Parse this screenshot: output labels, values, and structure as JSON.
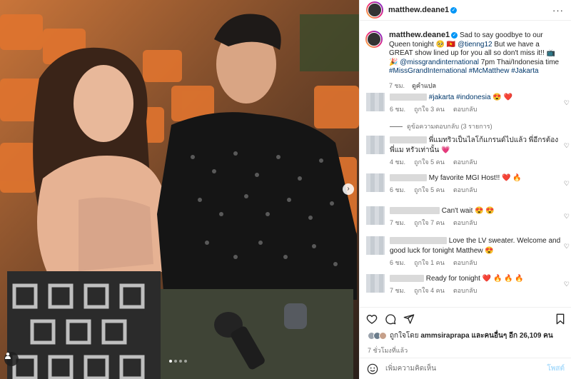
{
  "post": {
    "username": "matthew.deane1",
    "caption_pre": "Sad to say goodbye to our Queen tonight 🥺 🇻🇳 ",
    "mention_1": "@tienng12",
    "caption_mid": " But we have a GREAT show lined up for you all so don't miss it!! 📺 🎉 ",
    "mention_2": "@missgrandinternational",
    "caption_time": " 7pm Thai/Indonesia time ",
    "hashtag_1": "#MissGrandInternational",
    "hashtag_2": "#McMatthew",
    "hashtag_3": "#Jakarta",
    "time": "7 ชม.",
    "see_translation": "ดูคำแปล",
    "more_icon": "more-horizontal-icon"
  },
  "comments": [
    {
      "text_pre": "",
      "tags": "#jakarta #indonesia",
      "emoji": " 😍 ❤️",
      "time": "6 ชม.",
      "likes": "ถูกใจ 3 คน",
      "reply": "ตอบกลับ"
    },
    {
      "text_pre": "พี่แมทริวเป็นไลโก้แกรนด์ไปแล้ว พี่อีกรต้องพี่แม หรัวเท่านั้น 💗",
      "tags": "",
      "emoji": "",
      "time": "4 ชม.",
      "likes": "ถูกใจ 5 คน",
      "reply": "ตอบกลับ"
    },
    {
      "text_pre": "My favorite MGI Host!! ❤️ 🔥",
      "tags": "",
      "emoji": "",
      "time": "6 ชม.",
      "likes": "ถูกใจ 5 คน",
      "reply": "ตอบกลับ"
    },
    {
      "text_pre": "Can't wait 😍 😍",
      "tags": "",
      "emoji": "",
      "time": "7 ชม.",
      "likes": "ถูกใจ 7 คน",
      "reply": "ตอบกลับ"
    },
    {
      "text_pre": "Love the LV sweater. Welcome and good luck for tonight Matthew 😍",
      "tags": "",
      "emoji": "",
      "time": "6 ชม.",
      "likes": "ถูกใจ 1 คน",
      "reply": "ตอบกลับ"
    },
    {
      "text_pre": "Ready for tonight ❤️ 🔥 🔥 🔥",
      "tags": "",
      "emoji": "",
      "time": "7 ชม.",
      "likes": "ถูกใจ 4 คน",
      "reply": "ตอบกลับ"
    }
  ],
  "view_replies": "ดูข้อความตอบกลับ (3 รายการ)",
  "actions": {
    "liked_by_prefix": "ถูกใจโดย ",
    "liked_by_user": "ammsiraprapa",
    "liked_by_suffix": " และคนอื่นๆ อีก 26,109 คน",
    "time_ago": "7 ชั่วโมงที่แล้ว"
  },
  "add_comment": {
    "placeholder": "เพิ่มความคิดเห็น",
    "post_label": "โพสต์"
  },
  "colors": {
    "accent": "#0095f6",
    "link": "#00376b",
    "muted": "#737373"
  }
}
